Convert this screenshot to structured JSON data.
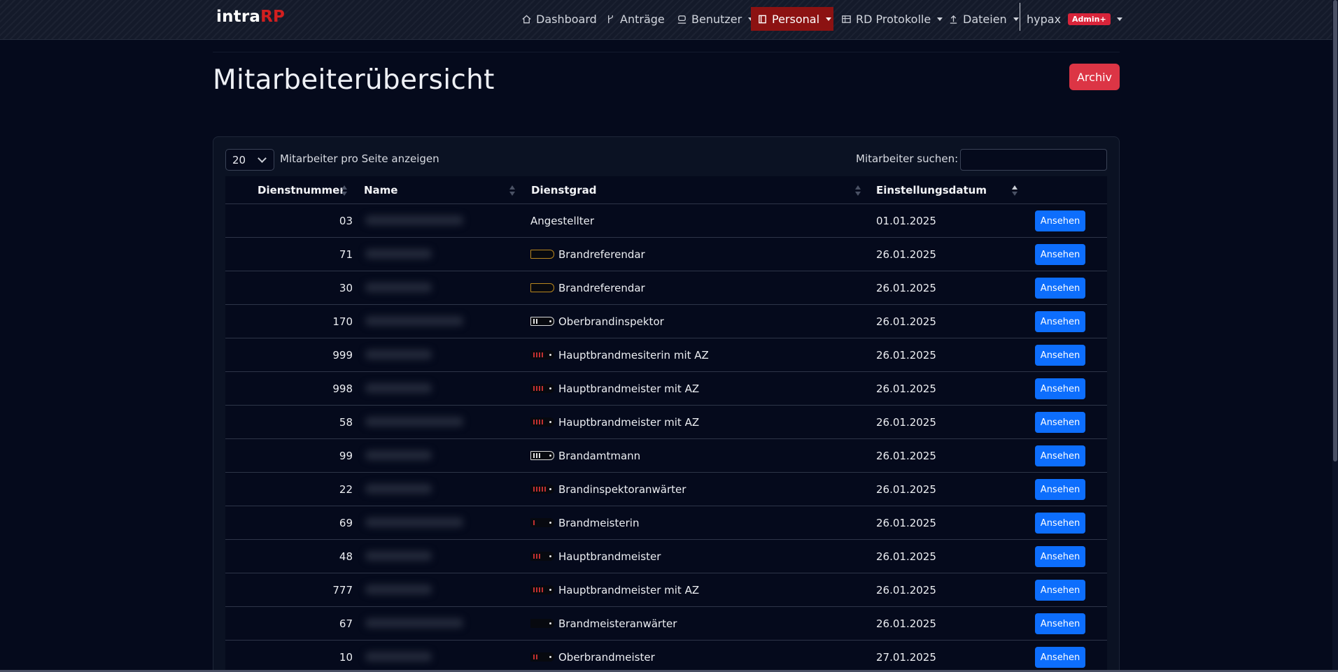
{
  "navbar": {
    "brand_part1": "intra",
    "brand_part2": "RP",
    "items": [
      {
        "label": "Dashboard",
        "icon": "home-icon"
      },
      {
        "label": "Anträge",
        "icon": "branch-icon"
      },
      {
        "label": "Benutzer",
        "icon": "users-icon"
      },
      {
        "label": "Personal",
        "icon": "badge-icon"
      },
      {
        "label": "RD Protokolle",
        "icon": "table-icon"
      },
      {
        "label": "Dateien",
        "icon": "upload-icon"
      }
    ],
    "user": "hypax",
    "user_badge": "Admin+",
    "active_color": "#8c1212"
  },
  "page": {
    "title": "Mitarbeiterübersicht",
    "archive_button": "Archiv"
  },
  "controls": {
    "page_length": "20",
    "page_length_label": "Mitarbeiter pro Seite anzeigen",
    "search_label": "Mitarbeiter suchen:",
    "search_value": ""
  },
  "table": {
    "columns": [
      "Dienstnummer",
      "Name",
      "Dienstgrad",
      "Einstellungsdatum"
    ],
    "view_label": "Ansehen",
    "rows": [
      {
        "nr": "03",
        "rank": "Angestellter",
        "date": "01.01.2025",
        "insignia": "none"
      },
      {
        "nr": "71",
        "rank": "Brandreferendar",
        "date": "26.01.2025",
        "insignia": "gold-plain"
      },
      {
        "nr": "30",
        "rank": "Brandreferendar",
        "date": "26.01.2025",
        "insignia": "gold-plain"
      },
      {
        "nr": "170",
        "rank": "Oberbrandinspektor",
        "date": "26.01.2025",
        "insignia": "silver-2"
      },
      {
        "nr": "999",
        "rank": "Hauptbrandmesiterin mit AZ",
        "date": "26.01.2025",
        "insignia": "red-4"
      },
      {
        "nr": "998",
        "rank": "Hauptbrandmeister mit AZ",
        "date": "26.01.2025",
        "insignia": "red-4"
      },
      {
        "nr": "58",
        "rank": "Hauptbrandmeister mit AZ",
        "date": "26.01.2025",
        "insignia": "red-4"
      },
      {
        "nr": "99",
        "rank": "Brandamtmann",
        "date": "26.01.2025",
        "insignia": "silver-3"
      },
      {
        "nr": "22",
        "rank": "Brandinspektoranwärter",
        "date": "26.01.2025",
        "insignia": "red-5"
      },
      {
        "nr": "69",
        "rank": "Brandmeisterin",
        "date": "26.01.2025",
        "insignia": "red-1"
      },
      {
        "nr": "48",
        "rank": "Hauptbrandmeister",
        "date": "26.01.2025",
        "insignia": "red-3"
      },
      {
        "nr": "777",
        "rank": "Hauptbrandmeister mit AZ",
        "date": "26.01.2025",
        "insignia": "red-4"
      },
      {
        "nr": "67",
        "rank": "Brandmeisteranwärter",
        "date": "26.01.2025",
        "insignia": "red-0"
      },
      {
        "nr": "10",
        "rank": "Oberbrandmeister",
        "date": "27.01.2025",
        "insignia": "red-2"
      }
    ]
  }
}
